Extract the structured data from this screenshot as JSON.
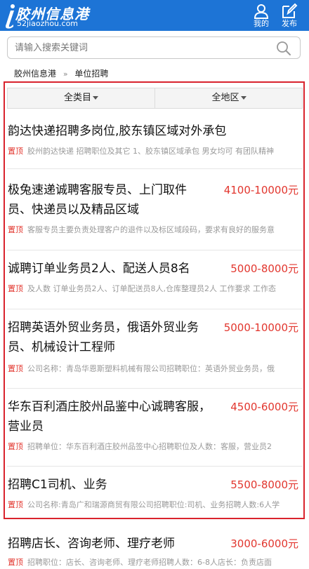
{
  "header": {
    "logo_title": "胶州信息港",
    "logo_url": "52jiaozhou.com",
    "me_label": "我的",
    "post_label": "发布"
  },
  "search": {
    "placeholder": "请输入搜索关键词",
    "value": ""
  },
  "breadcrumb": {
    "home": "胶州信息港",
    "separator": "»",
    "current": "单位招聘"
  },
  "filters": {
    "category": "全类目",
    "region": "全地区"
  },
  "colors": {
    "header_bg": "#1d74d6",
    "salary": "#e2362e",
    "highlight_border": "#d9232d"
  },
  "listings": [
    {
      "title": "韵达快递招聘多岗位,胶东镇区域对外承包",
      "salary": "",
      "tag": "置顶",
      "desc": "胶州韵达快递 招聘职位及其它 1、胶东镇区域承包 男女均可 有团队精神"
    },
    {
      "title": "极兔速递诚聘客服专员、上门取件员、快递员以及精品区域",
      "salary": "4100-10000元",
      "tag": "置顶",
      "desc": "客服专员主要负责处理客户的退件以及标区域段码，要求有良好的服务意"
    },
    {
      "title": "诚聘订单业务员2人、配送人员8名",
      "salary": "5000-8000元",
      "tag": "置顶",
      "desc": "及人数 订单业务员2人、订单配送员8人,仓库整理员2人 工作要求 工作态"
    },
    {
      "title": "招聘英语外贸业务员，俄语外贸业务员、机械设计工程师",
      "salary": "5000-10000元",
      "tag": "置顶",
      "desc": "公司名称：青岛华恩斯塑料机械有限公司招聘职位：英语外贸业务员，俄"
    },
    {
      "title": "华东百利酒庄胶州品鉴中心诚聘客服，营业员",
      "salary": "4500-6000元",
      "tag": "置顶",
      "desc": "招聘单位：华东百利酒庄胶州品签中心招聘职位及人数：客服，营业员2"
    },
    {
      "title": "招聘C1司机、业务",
      "salary": "5500-8000元",
      "tag": "置顶",
      "desc": "公司名称:青岛广和瑞源商贸有限公司招聘职位:司机、业务招聘人数:6人学"
    },
    {
      "title": "招聘店长、咨询老师、理疗老师",
      "salary": "3000-6000元",
      "tag": "置顶",
      "desc": "招聘职位：店长、咨询老师、理疗老师招聘人数：6-8人店长：负责店面"
    }
  ]
}
